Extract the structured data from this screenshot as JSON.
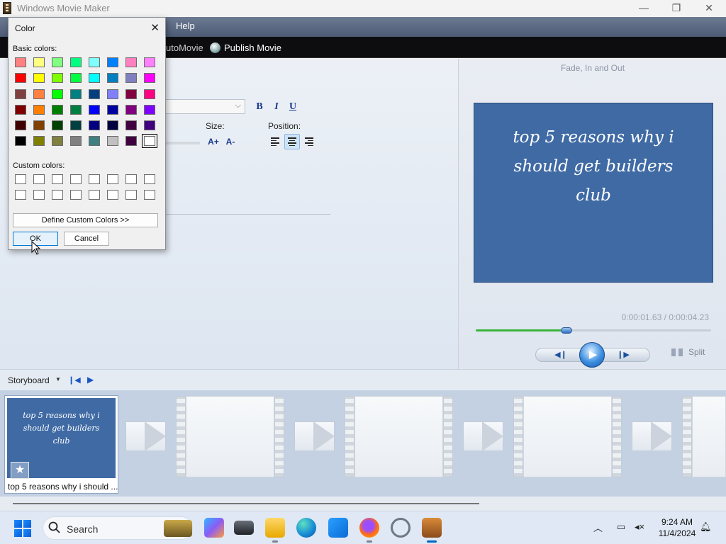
{
  "window": {
    "title": "Windows Movie Maker",
    "minimize": "—",
    "maximize": "❐",
    "close": "✕"
  },
  "menu": {
    "help": "Help"
  },
  "toolbar": {
    "automovie": "utoMovie",
    "publish": "Publish Movie"
  },
  "editor": {
    "bold": "B",
    "italic": "I",
    "underline": "U",
    "size_label": "Size:",
    "position_label": "Position:",
    "grow_icon": "A+",
    "shrink_icon": "A-",
    "selected_alignment": "center"
  },
  "preview": {
    "title": "Fade, In and Out",
    "caption": "top 5 reasons why i should get builders club",
    "time": "0:00:01.63 / 0:00:04.23",
    "progress": 0.385,
    "split_label": "Split"
  },
  "storyboard": {
    "label": "Storyboard",
    "clip1": {
      "caption": "top 5 reasons why i should get builders club",
      "label": "top 5 reasons why i should ..."
    }
  },
  "color_dialog": {
    "title": "Color",
    "basic_label": "Basic colors:",
    "custom_label": "Custom colors:",
    "define_button": "Define Custom Colors >>",
    "ok_button": "OK",
    "cancel_button": "Cancel",
    "basic_colors": [
      "#ff8080",
      "#ffff80",
      "#80ff80",
      "#00ff80",
      "#80ffff",
      "#0080ff",
      "#ff80c0",
      "#ff80ff",
      "#ff0000",
      "#ffff00",
      "#80ff00",
      "#00ff40",
      "#00ffff",
      "#0080c0",
      "#8080c0",
      "#ff00ff",
      "#804040",
      "#ff8040",
      "#00ff00",
      "#008080",
      "#004080",
      "#8080ff",
      "#800040",
      "#ff0080",
      "#800000",
      "#ff8000",
      "#008000",
      "#008040",
      "#0000ff",
      "#0000a0",
      "#800080",
      "#8000ff",
      "#400000",
      "#804000",
      "#004000",
      "#004040",
      "#000080",
      "#000040",
      "#400040",
      "#400080",
      "#000000",
      "#808000",
      "#808040",
      "#808080",
      "#408080",
      "#c0c0c0",
      "#400040",
      "#ffffff"
    ],
    "selected_index": 47,
    "custom_colors": [
      "#ffffff",
      "#ffffff",
      "#ffffff",
      "#ffffff",
      "#ffffff",
      "#ffffff",
      "#ffffff",
      "#ffffff",
      "#ffffff",
      "#ffffff",
      "#ffffff",
      "#ffffff",
      "#ffffff",
      "#ffffff",
      "#ffffff",
      "#ffffff"
    ]
  },
  "taskbar": {
    "search_placeholder": "Search",
    "time": "9:24 AM",
    "date": "11/4/2024",
    "apps": [
      "copilot-icon",
      "file-explorer-dark-icon",
      "file-explorer-icon",
      "edge-icon",
      "store-icon",
      "firefox-icon",
      "sync-icon",
      "movie-maker-icon"
    ]
  },
  "colors": {
    "accent": "#0078d7",
    "preview_bg": "#3f6aa4",
    "progress": "#3bb53b"
  }
}
